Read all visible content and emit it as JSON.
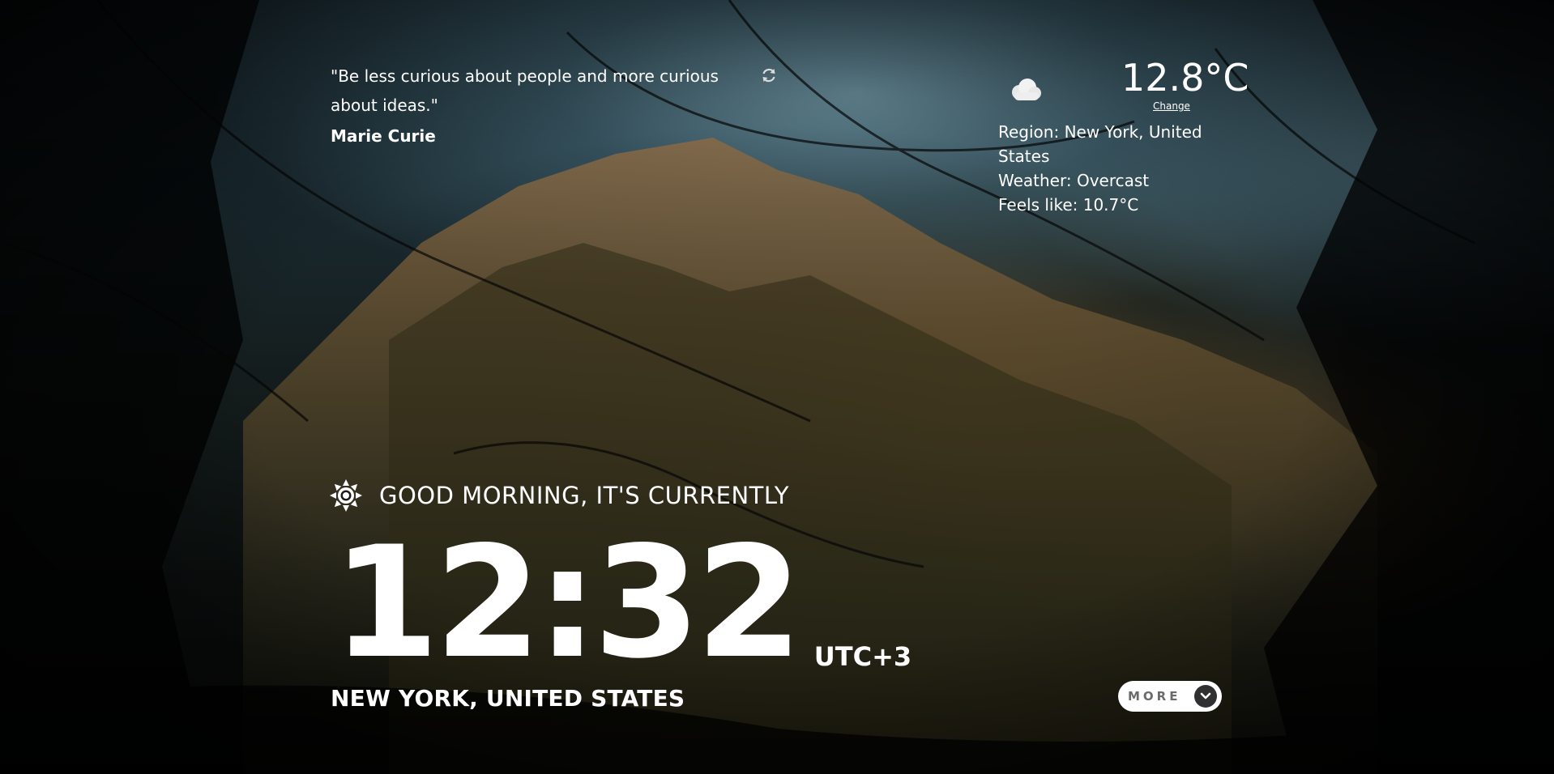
{
  "quote": {
    "text": "\"Be less curious about people and more curious about ideas.\"",
    "author": "Marie Curie",
    "refresh_icon": "refresh-icon"
  },
  "weather": {
    "icon": "cloud-icon",
    "temperature": "12.8°C",
    "change_label": "Change",
    "region": "Region: New York, United States",
    "condition": "Weather: Overcast",
    "feels_like": "Feels like: 10.7°C"
  },
  "greeting": {
    "icon": "sun-icon",
    "text": "GOOD MORNING, IT'S CURRENTLY"
  },
  "clock": {
    "time": "12:32",
    "timezone": "UTC+3",
    "location": "NEW YORK, UNITED STATES"
  },
  "more_button": {
    "label": "MORE",
    "icon": "chevron-down-icon"
  },
  "colors": {
    "text": "#ffffff",
    "button_bg": "#ffffff",
    "button_text": "#6b6b6b",
    "arrow_bg": "#303030"
  }
}
